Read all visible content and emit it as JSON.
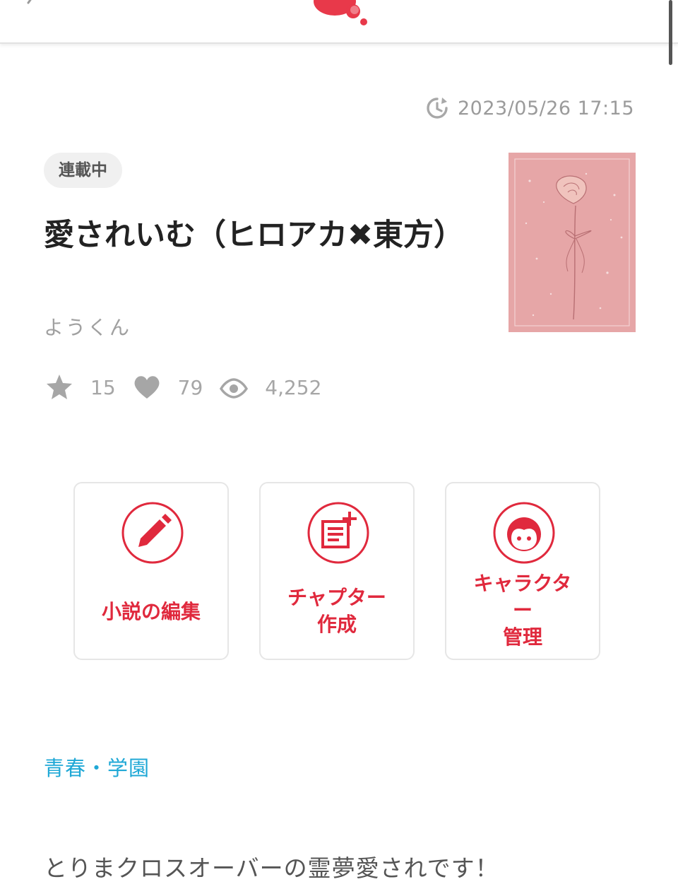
{
  "header": {
    "back_icon": "chevron-left-icon",
    "logo_icon": "brand-logo-icon",
    "accent_color": "#e0293d"
  },
  "meta": {
    "updated_at": "2023/05/26 17:15",
    "updated_icon": "clock-refresh-icon"
  },
  "novel": {
    "status_badge": "連載中",
    "title": "愛されいむ（ヒロアカ✖東方）",
    "author": "ようくん",
    "cover_icon": "rose-cover-image",
    "stats": {
      "stars": "15",
      "likes": "79",
      "views": "4,252"
    }
  },
  "actions": [
    {
      "label": "小説の編集",
      "icon": "pencil-icon"
    },
    {
      "label_line1": "チャプター",
      "label_line2": "作成",
      "icon": "add-note-icon"
    },
    {
      "label_line1": "キャラクタ",
      "label_line2": "ー",
      "label_line3": "管理",
      "icon": "face-icon"
    }
  ],
  "genre": "青春・学園",
  "description": "とりまクロスオーバーの霊夢愛されです！"
}
